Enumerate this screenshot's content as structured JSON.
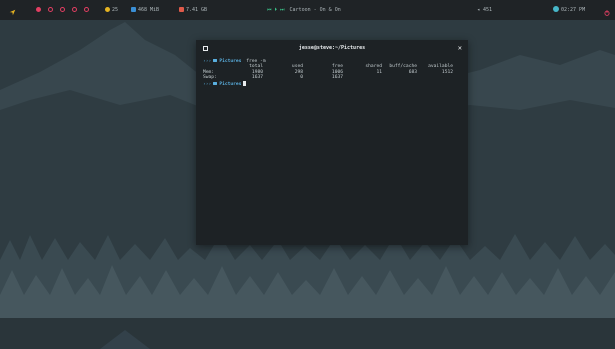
{
  "topbar": {
    "workspaces": [
      {
        "active": true
      },
      {
        "active": false
      },
      {
        "active": false
      },
      {
        "active": false
      },
      {
        "active": false
      }
    ],
    "updates": "25",
    "memory": "468 MiB",
    "disk": "7.41 GB",
    "media_controls": "⏮ ⏵ ⏭",
    "now_playing": "Cartoon - On & On",
    "volume": "451",
    "clock": "02:27 PM",
    "colors": {
      "bar_bg": "#1f2326",
      "accent_red": "#e23e62",
      "accent_yellow": "#e6b422",
      "accent_blue": "#3a8fd6",
      "accent_green": "#3cc48a",
      "accent_cyan": "#47b7c9"
    }
  },
  "terminal": {
    "title": "jesse@steve:~/Pictures",
    "close_label": "✕",
    "prompt": {
      "arrow": "›››",
      "directory": "Pictures",
      "command": "free -m"
    },
    "table": {
      "headers": [
        "total",
        "used",
        "free",
        "shared",
        "buff/cache",
        "available"
      ],
      "rows": [
        {
          "label": "Mem:",
          "values": [
            "1980",
            "298",
            "1006",
            "11",
            "683",
            "1512"
          ]
        },
        {
          "label": "Swap:",
          "values": [
            "1637",
            "0",
            "1637",
            "",
            "",
            ""
          ]
        }
      ]
    },
    "prompt2": {
      "arrow": "›››",
      "directory": "Pictures"
    }
  }
}
